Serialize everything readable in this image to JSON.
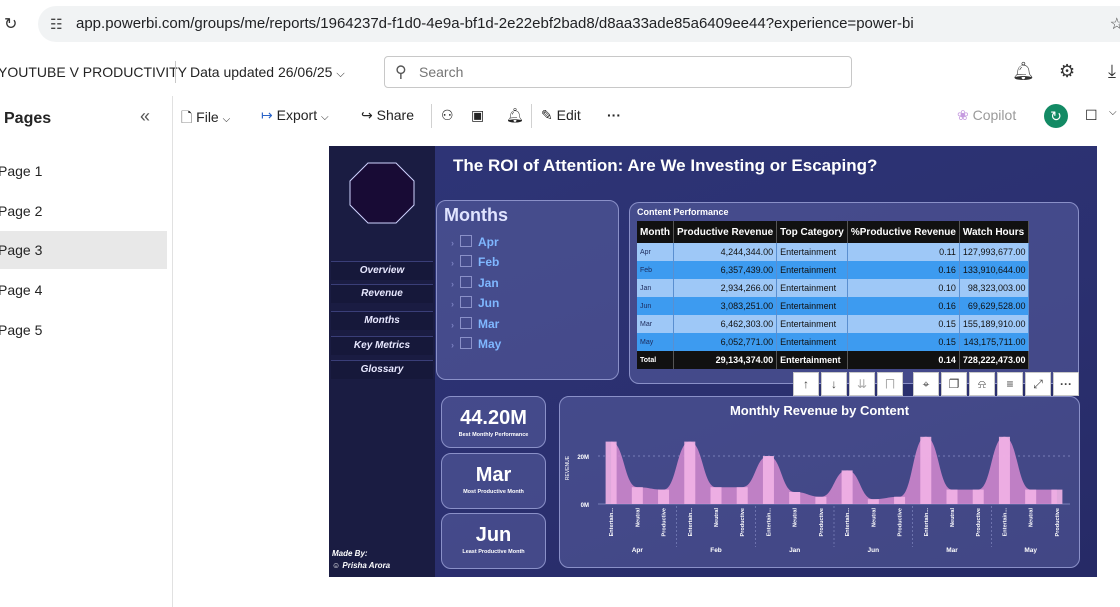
{
  "browser": {
    "url": "app.powerbi.com/groups/me/reports/1964237d-f1d0-4e9a-bf1d-2e22ebf2bad8/d8aa33ade85a6409ee44?experience=power-bi"
  },
  "header": {
    "app_name": "YOUTUBE V PRODUCTIVITY",
    "data_updated": "Data updated 26/06/25",
    "search_placeholder": "Search"
  },
  "pages_panel": {
    "title": "Pages",
    "items": [
      {
        "label": "Page 1"
      },
      {
        "label": "Page 2"
      },
      {
        "label": "Page 3",
        "active": true
      },
      {
        "label": "Page 4"
      },
      {
        "label": "Page 5"
      }
    ]
  },
  "actionbar": {
    "file": "File",
    "export": "Export",
    "share": "Share",
    "edit": "Edit",
    "copilot": "Copilot"
  },
  "report": {
    "title": "The ROI of Attention: Are We Investing or Escaping?",
    "nav": [
      "Overview",
      "Revenue",
      "Months",
      "Key Metrics",
      "Glossary"
    ],
    "made_by_label": "Made By:",
    "made_by_name": "Prisha Arora",
    "months_slicer": {
      "title": "Months",
      "items": [
        "Apr",
        "Feb",
        "Jan",
        "Jun",
        "Mar",
        "May"
      ]
    },
    "content_performance": {
      "title": "Content Performance",
      "columns": [
        "Month",
        "Productive Revenue",
        "Top Category",
        "%Productive Revenue",
        "Watch Hours"
      ],
      "rows": [
        [
          "Apr",
          "4,244,344.00",
          "Entertainment",
          "0.11",
          "127,993,677.00"
        ],
        [
          "Feb",
          "6,357,439.00",
          "Entertainment",
          "0.16",
          "133,910,644.00"
        ],
        [
          "Jan",
          "2,934,266.00",
          "Entertainment",
          "0.10",
          "98,323,003.00"
        ],
        [
          "Jun",
          "3,083,251.00",
          "Entertainment",
          "0.16",
          "69,629,528.00"
        ],
        [
          "Mar",
          "6,462,303.00",
          "Entertainment",
          "0.15",
          "155,189,910.00"
        ],
        [
          "May",
          "6,052,771.00",
          "Entertainment",
          "0.15",
          "143,175,711.00"
        ]
      ],
      "total": [
        "Total",
        "29,134,374.00",
        "Entertainment",
        "0.14",
        "728,222,473.00"
      ]
    },
    "kpis": [
      {
        "value": "44.20M",
        "label": "Best Monthly Performance"
      },
      {
        "value": "Mar",
        "label": "Most Productive Month"
      },
      {
        "value": "Jun",
        "label": "Least Productive Month"
      }
    ]
  },
  "chart_data": {
    "type": "area",
    "title": "Monthly Revenue by Content",
    "ylabel": "REVENUE",
    "xlabel": "",
    "y_ticks": [
      "0M",
      "20M"
    ],
    "ylim": [
      0,
      30
    ],
    "months": [
      "Apr",
      "Feb",
      "Jan",
      "Jun",
      "Mar",
      "May"
    ],
    "categories": [
      "Entertain...",
      "Neutral",
      "Productive"
    ],
    "values_millions": [
      [
        26,
        7,
        6
      ],
      [
        26,
        7,
        7
      ],
      [
        20,
        5,
        3
      ],
      [
        14,
        2,
        3
      ],
      [
        28,
        6,
        6
      ],
      [
        28,
        6,
        6
      ]
    ],
    "colors": {
      "area": "#d58ad0",
      "bar": "#f2b3e6",
      "grid": "#8a90c8"
    }
  }
}
